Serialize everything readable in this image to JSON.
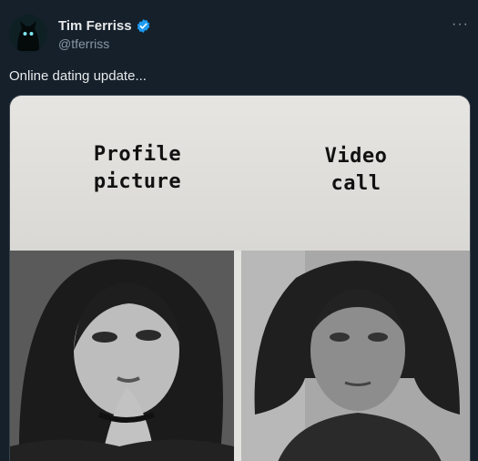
{
  "author": {
    "name": "Tim Ferriss",
    "handle": "@tferriss",
    "verified": true,
    "avatar_icon": "black-cat-avatar-icon"
  },
  "menu": {
    "label": "···"
  },
  "tweet": {
    "text": "Online dating update..."
  },
  "meme": {
    "left_caption_line1": "Profile",
    "left_caption_line2": "picture",
    "right_caption_line1": "Video",
    "right_caption_line2": "call"
  },
  "colors": {
    "background": "#15202b",
    "verified_badge": "#1d9bf0",
    "handle": "#8b98a5"
  }
}
